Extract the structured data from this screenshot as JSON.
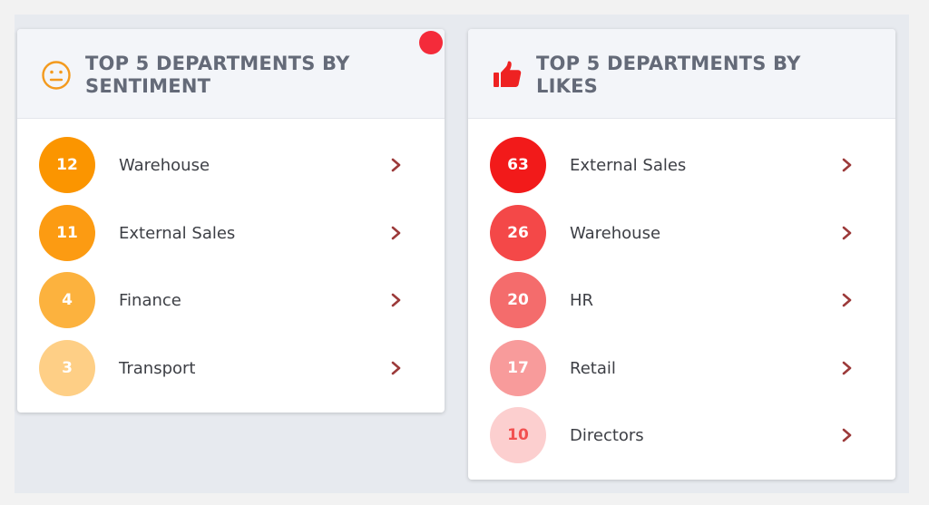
{
  "colors": {
    "header_bg": "#f3f5f9",
    "title_text": "#646a78",
    "label_text": "#3d3f45",
    "chevron": "#9c3a3a",
    "notification_dot": "#f42b3a",
    "smiley_icon": "#f39a1e",
    "thumbs_up_icon": "#ee2222"
  },
  "sentiment_card": {
    "title": "TOP 5 DEPARTMENTS BY SENTIMENT",
    "icon": "smiley-face-icon",
    "items": [
      {
        "count": "12",
        "label": "Warehouse",
        "color": "#fb9500",
        "text_color": "#ffffff"
      },
      {
        "count": "11",
        "label": "External Sales",
        "color": "#fc9b12",
        "text_color": "#ffffff"
      },
      {
        "count": "4",
        "label": "Finance",
        "color": "#fcb23e",
        "text_color": "#ffffff"
      },
      {
        "count": "3",
        "label": "Transport",
        "color": "#fecf86",
        "text_color": "#ffffff"
      }
    ]
  },
  "likes_card": {
    "title": "TOP 5 DEPARTMENTS BY LIKES",
    "icon": "thumbs-up-icon",
    "items": [
      {
        "count": "63",
        "label": "External Sales",
        "color": "#f21a1a",
        "text_color": "#ffffff"
      },
      {
        "count": "26",
        "label": "Warehouse",
        "color": "#f44848",
        "text_color": "#ffffff"
      },
      {
        "count": "20",
        "label": "HR",
        "color": "#f46c6c",
        "text_color": "#ffffff"
      },
      {
        "count": "17",
        "label": "Retail",
        "color": "#f89b9b",
        "text_color": "#ffffff"
      },
      {
        "count": "10",
        "label": "Directors",
        "color": "#fccfcf",
        "text_color": "#f25050"
      }
    ]
  }
}
